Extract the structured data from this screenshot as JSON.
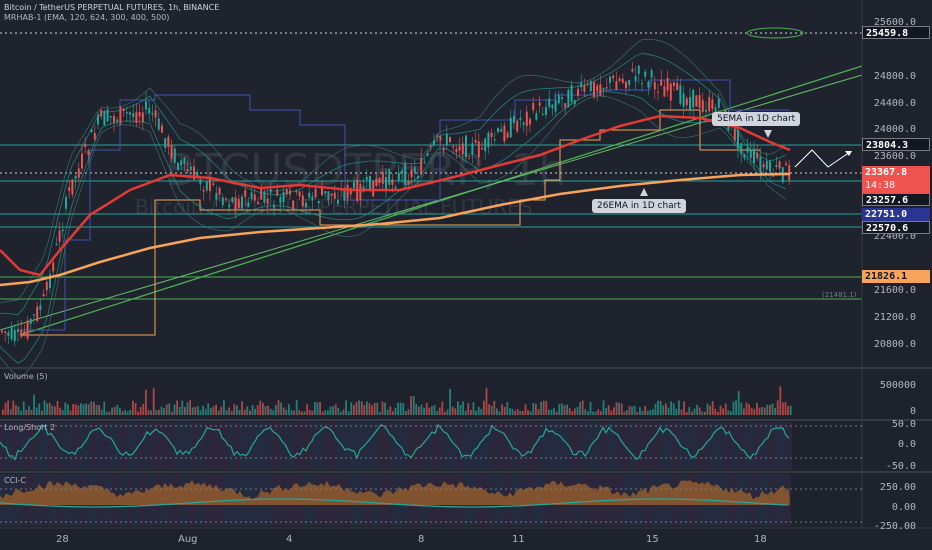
{
  "header": {
    "title": "Bitcoin / TetherUS PERPETUAL FUTURES, 1h, BINANCE",
    "indicator": "MRHAB-1 (EMA, 120, 624, 300, 400, 500)"
  },
  "watermark": {
    "symbol": "BTCUSDTPERP, 1h",
    "description": "Bitcoin / TetherUS PERPETUAL FUTURES"
  },
  "callouts": {
    "ema_5": "5EMA in 1D chart",
    "ema_26": "26EMA in 1D chart"
  },
  "price_axis": [
    "25600.0",
    "24800.0",
    "24400.0",
    "24000.0",
    "23600.0",
    "22400.0",
    "21600.0",
    "21200.0",
    "20800.0"
  ],
  "price_tags": {
    "high": "25459.8",
    "level_1": "23804.3",
    "current": "23367.8",
    "countdown": "14:38",
    "level_2": "23257.6",
    "level_3": "22751.0",
    "level_4": "22570.6",
    "level_5": "21826.1",
    "low_note": "(21481.1)"
  },
  "volume_pane": {
    "label": "Volume (5)",
    "axis": [
      "500000",
      "0"
    ]
  },
  "longshort_pane": {
    "label": "Long/Short 2",
    "axis": [
      "50.0",
      "0.0",
      "-50.0"
    ]
  },
  "cci_pane": {
    "label": "CCI-C",
    "axis": [
      "250.00",
      "0.00",
      "-250.00"
    ]
  },
  "time_axis": [
    "28",
    "Aug",
    "4",
    "8",
    "11",
    "15",
    "18"
  ],
  "colors": {
    "background": "#1e222d",
    "ema_red": "#e53935",
    "ema_orange": "#f7a35c",
    "trendline_green": "#4caf50",
    "level_green": "#26a69a",
    "tag_blue": "#283593",
    "tag_red": "#ef5350",
    "tag_orange": "#f7a35c"
  }
}
